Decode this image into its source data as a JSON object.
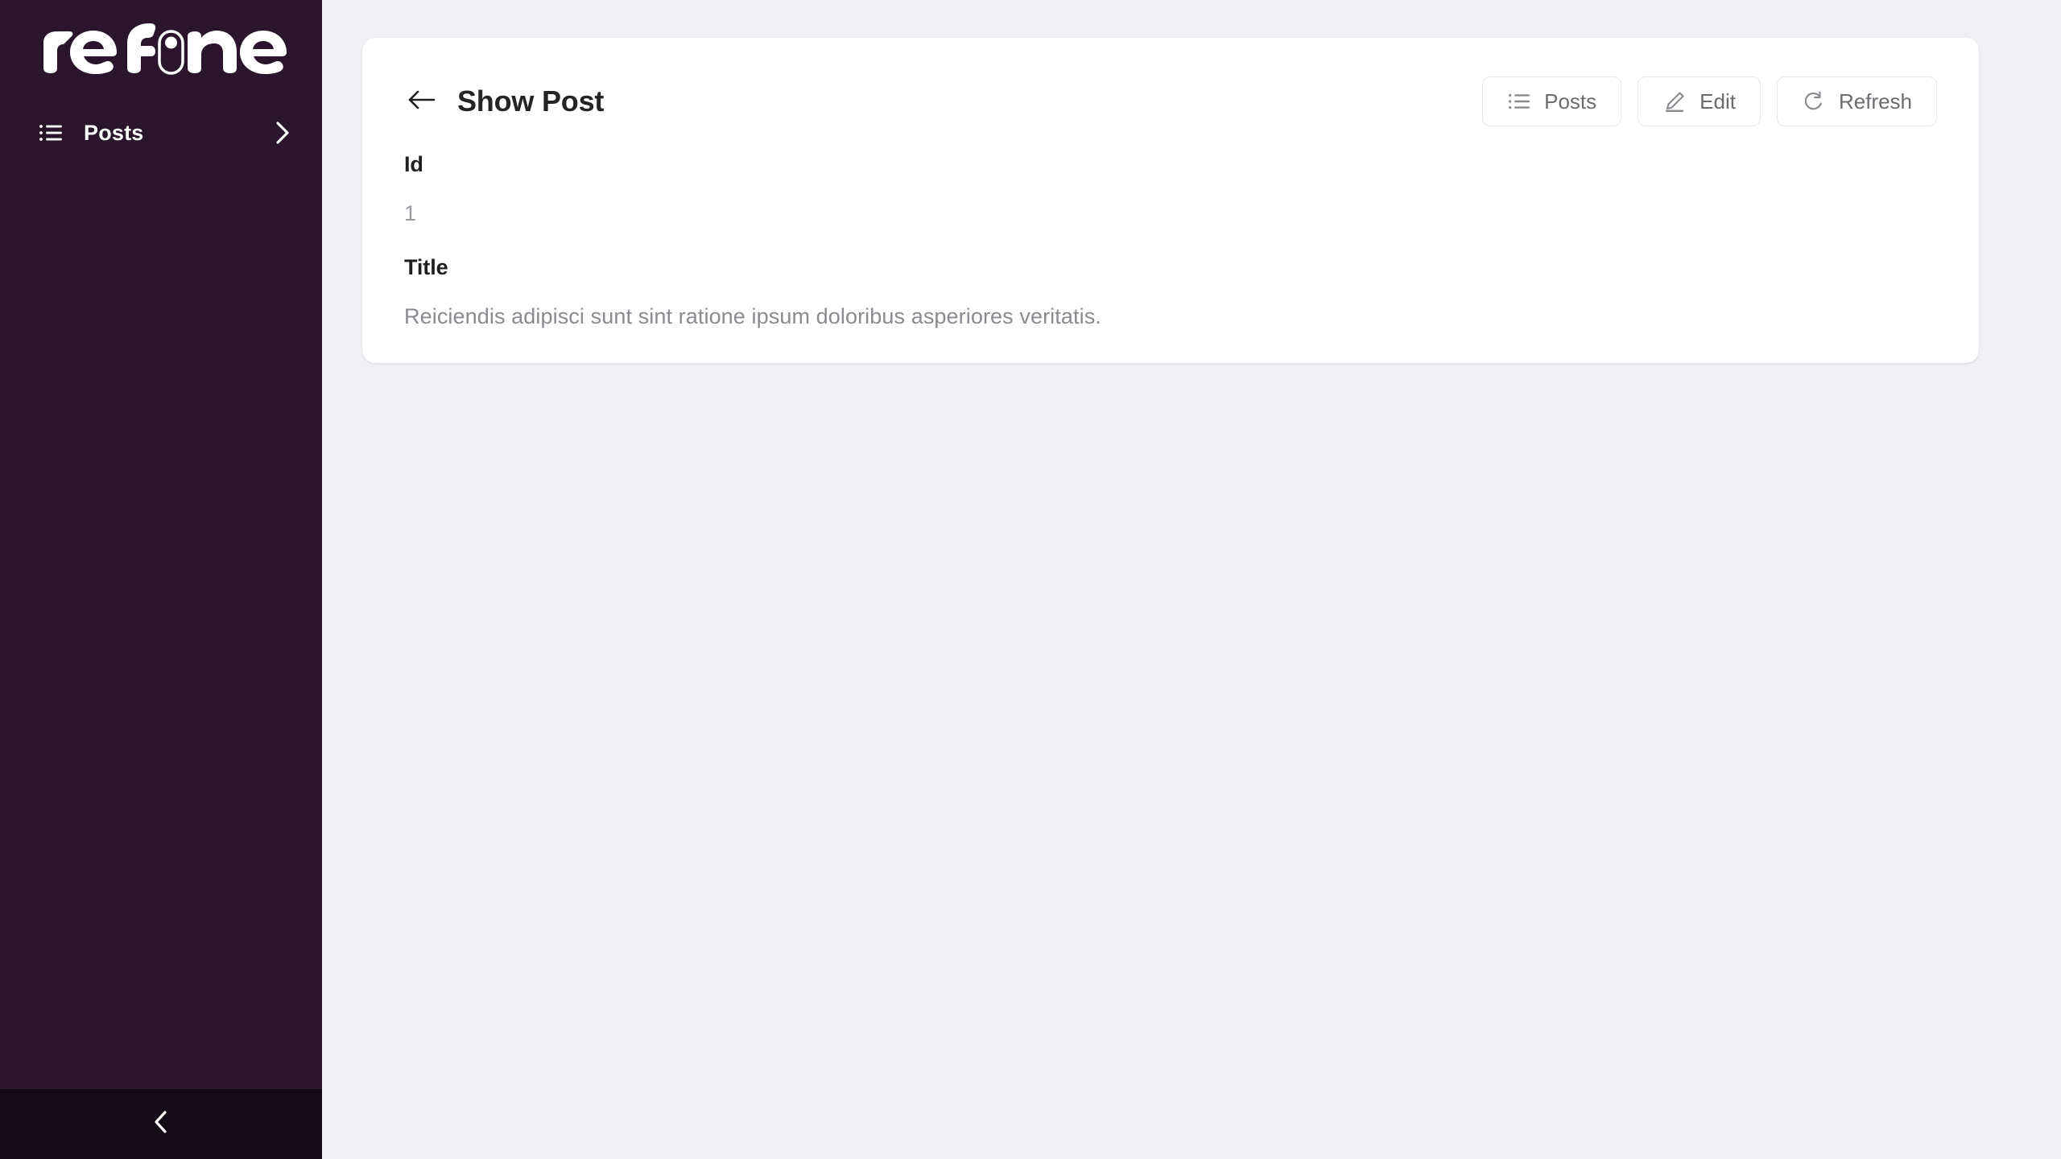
{
  "sidebar": {
    "logo_text": "refine",
    "logo_name": "refine-logo",
    "items": [
      {
        "label": "Posts",
        "icon": "list-icon",
        "chevron": "chevron-right-icon"
      }
    ],
    "collapse": {
      "icon": "chevron-left-icon",
      "label": ""
    }
  },
  "header": {
    "back_icon": "arrow-left-icon",
    "title": "Show Post",
    "actions": [
      {
        "label": "Posts",
        "icon": "list-icon"
      },
      {
        "label": "Edit",
        "icon": "pencil-icon"
      },
      {
        "label": "Refresh",
        "icon": "refresh-icon"
      }
    ]
  },
  "content": {
    "fields": [
      {
        "label": "Id",
        "value": "1"
      },
      {
        "label": "Title",
        "value": "Reiciendis adipisci sunt sint ratione ipsum doloribus asperiores veritatis."
      }
    ]
  },
  "colors": {
    "sidebar_bg": "#2a152c",
    "collapse_bg": "#150a17",
    "page_bg": "#f0f0f4",
    "card_bg": "#ffffff",
    "title_text": "#242424",
    "muted_text": "#8a8a90",
    "border": "#e6e6e8"
  }
}
